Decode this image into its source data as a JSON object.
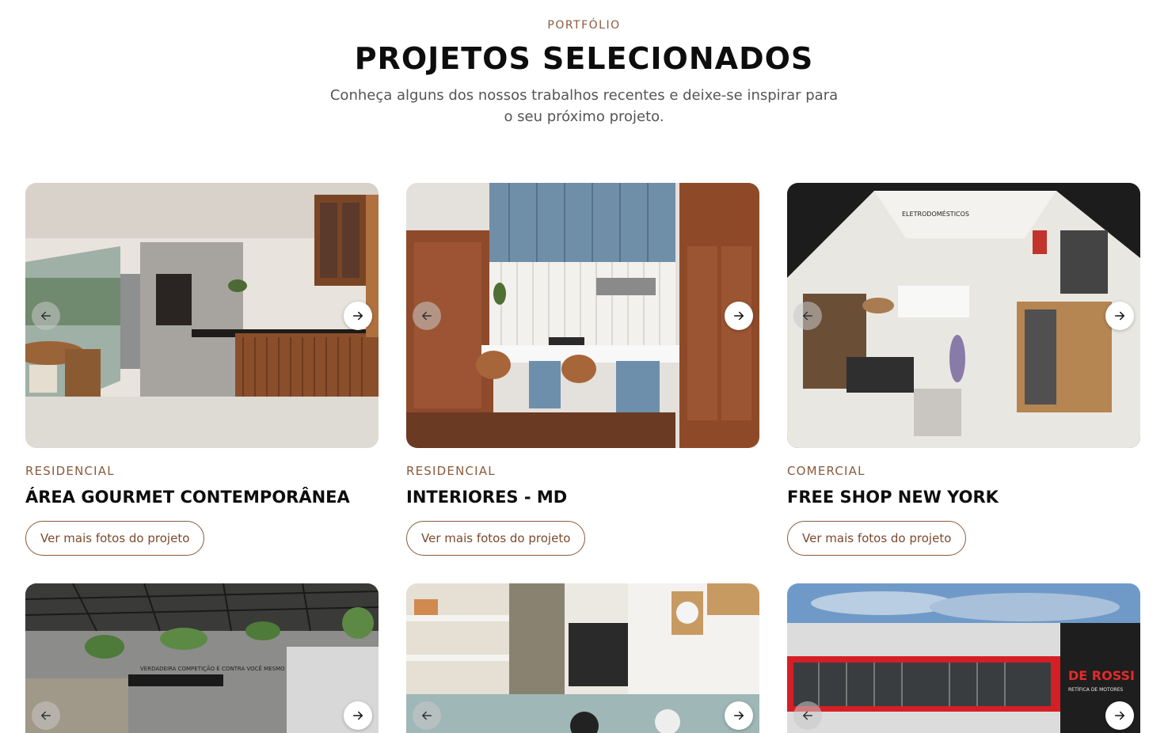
{
  "section": {
    "eyebrow": "PORTFÓLIO",
    "title": "PROJETOS SELECIONADOS",
    "subtitle": "Conheça alguns dos nossos trabalhos recentes e deixe-se inspirar para o seu próximo projeto."
  },
  "projects": [
    {
      "category": "RESIDENCIAL",
      "name": "ÁREA GOURMET CONTEMPORÂNEA",
      "button": "Ver mais fotos do projeto"
    },
    {
      "category": "RESIDENCIAL",
      "name": "INTERIORES - MD",
      "button": "Ver mais fotos do projeto"
    },
    {
      "category": "COMERCIAL",
      "name": "FREE SHOP NEW YORK",
      "button": "Ver mais fotos do projeto"
    }
  ],
  "image_labels": {
    "store_sign": "ELETRODOMÉSTICOS",
    "gym_wall_text": "VERDADEIRA COMPETIÇÃO É CONTRA VOCÊ MESMO",
    "building_logo": "DE ROSSI",
    "building_sub": "RETÍFICA DE MOTORES"
  },
  "icons": {
    "prev": "arrow-left-icon",
    "next": "arrow-right-icon"
  },
  "colors": {
    "accent": "#8a5a3c",
    "title": "#0d0d0d",
    "text": "#555555"
  }
}
